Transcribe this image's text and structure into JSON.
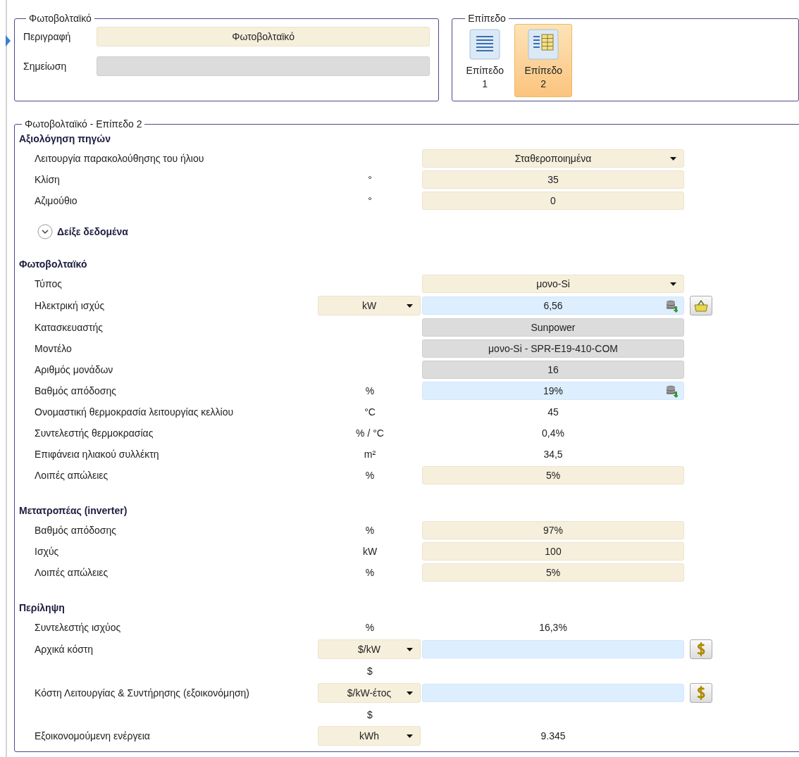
{
  "general": {
    "title": "Φωτοβολταϊκό",
    "fields": [
      {
        "label": "Περιγραφή",
        "kind": "input",
        "value": "Φωτοβολταϊκό"
      },
      {
        "label": "Σημείωση",
        "kind": "readonly"
      }
    ]
  },
  "level": {
    "title": "Επίπεδο",
    "options": [
      {
        "label": "Επίπεδο 1",
        "kind": "list",
        "selected": false
      },
      {
        "label": "Επίπεδο 2",
        "kind": "table",
        "selected": true
      }
    ]
  },
  "details": {
    "title": "Φωτοβολταϊκό - Επίπεδο 2",
    "sections": [
      {
        "title": "Αξιολόγηση πηγών",
        "rows": [
          {
            "label": "Λειτουργία παρακολούθησης του ήλιου",
            "kind": "select",
            "value": "Σταθεροποιημένα"
          },
          {
            "label": "Κλίση",
            "unit": {
              "kind": "text",
              "text": "°"
            },
            "kind": "input",
            "value": "35"
          },
          {
            "label": "Αζιμούθιο",
            "unit": {
              "kind": "text",
              "text": "°"
            },
            "kind": "input",
            "value": "0"
          }
        ],
        "expander": {
          "label": "Δείξε δεδομένα",
          "expanded": false
        }
      },
      {
        "title": "Φωτοβολταϊκό",
        "rows": [
          {
            "label": "Τύπος",
            "kind": "select",
            "value": "μονο-Si"
          },
          {
            "label": "Ηλεκτρική ισχύς",
            "unit": {
              "kind": "select",
              "text": "kW"
            },
            "kind": "calc",
            "value": "6,56",
            "button": {
              "kind": "basket"
            }
          },
          {
            "label": "Κατασκευαστής",
            "kind": "readonly",
            "value": "Sunpower"
          },
          {
            "label": "Μοντέλο",
            "kind": "readonly",
            "value": "μονο-Si - SPR-E19-410-COM"
          },
          {
            "label": "Αριθμός μονάδων",
            "kind": "readonly",
            "value": "16"
          },
          {
            "label": "Βαθμός απόδοσης",
            "unit": {
              "kind": "text",
              "text": "%"
            },
            "kind": "calc",
            "value": "19%"
          },
          {
            "label": "Ονομαστική θερμοκρασία λειτουργίας κελλίου",
            "unit": {
              "kind": "text",
              "text": "°C"
            },
            "kind": "text",
            "value": "45"
          },
          {
            "label": "Συντελεστής θερμοκρασίας",
            "unit": {
              "kind": "text",
              "text": "% / °C"
            },
            "kind": "text",
            "value": "0,4%"
          },
          {
            "label": "Επιφάνεια ηλιακού συλλέκτη",
            "unit": {
              "kind": "text",
              "text": "m²"
            },
            "kind": "text",
            "value": "34,5"
          },
          {
            "label": "Λοιπές απώλειες",
            "unit": {
              "kind": "text",
              "text": "%"
            },
            "kind": "input",
            "value": "5%"
          }
        ]
      },
      {
        "title": "Μετατροπέας (inverter)",
        "rows": [
          {
            "label": "Βαθμός απόδοσης",
            "unit": {
              "kind": "text",
              "text": "%"
            },
            "kind": "input",
            "value": "97%"
          },
          {
            "label": "Ισχύς",
            "unit": {
              "kind": "text",
              "text": "kW"
            },
            "kind": "input",
            "value": "100"
          },
          {
            "label": "Λοιπές απώλειες",
            "unit": {
              "kind": "text",
              "text": "%"
            },
            "kind": "input",
            "value": "5%"
          }
        ]
      },
      {
        "title": "Περίληψη",
        "rows": [
          {
            "label": "Συντελεστής ισχύος",
            "unit": {
              "kind": "text",
              "text": "%"
            },
            "kind": "text",
            "value": "16,3%"
          },
          {
            "label": "Αρχικά κόστη",
            "unit": {
              "kind": "select",
              "text": "$/kW"
            },
            "kind": "blank",
            "button": {
              "kind": "dollar"
            }
          },
          {
            "unit": {
              "kind": "text",
              "text": "$"
            }
          },
          {
            "label": "Κόστη Λειτουργίας & Συντήρησης (εξοικονόμηση)",
            "unit": {
              "kind": "select",
              "text": "$/kW-έτος"
            },
            "kind": "blank",
            "button": {
              "kind": "dollar"
            }
          },
          {
            "unit": {
              "kind": "text",
              "text": "$"
            }
          },
          {
            "label": "Εξοικονομούμενη ενέργεια",
            "unit": {
              "kind": "select",
              "text": "kWh"
            },
            "kind": "text",
            "value": "9.345"
          }
        ]
      }
    ]
  }
}
